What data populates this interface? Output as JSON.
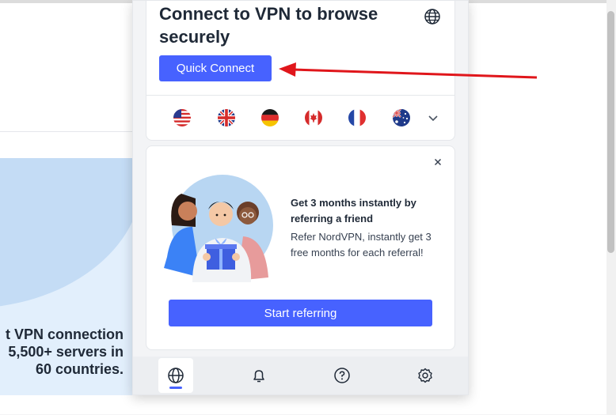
{
  "background_page": {
    "hero_lines": [
      "t VPN connection",
      "5,500+ servers in",
      "60 countries."
    ]
  },
  "connect_card": {
    "title": "Connect to VPN to browse securely",
    "quick_connect_label": "Quick Connect",
    "flags": [
      "us-flag",
      "uk-flag",
      "germany-flag",
      "canada-flag",
      "france-flag",
      "australia-flag"
    ]
  },
  "referral_card": {
    "heading": "Get 3 months instantly by referring a friend",
    "body": "Refer NordVPN, instantly get 3 free months for each referral!",
    "button_label": "Start referring"
  },
  "bottom_nav": {
    "items": [
      "globe-icon",
      "bell-icon",
      "help-icon",
      "settings-icon"
    ],
    "active": "globe-icon"
  },
  "colors": {
    "accent": "#4762ff",
    "annotation_arrow": "#e0161b"
  }
}
